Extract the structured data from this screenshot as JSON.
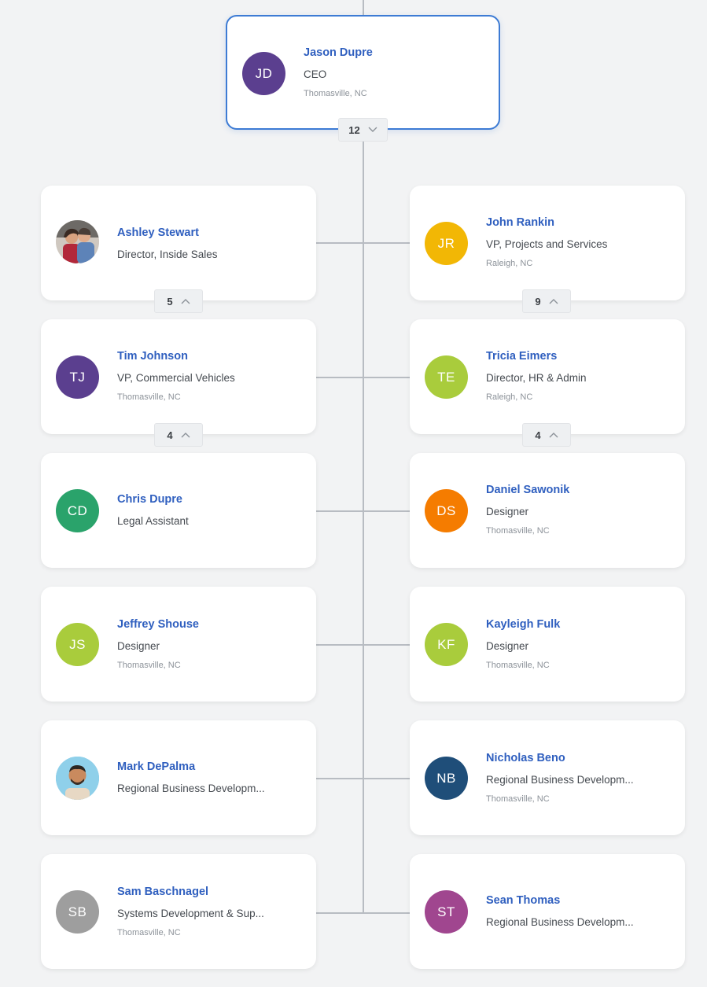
{
  "root": {
    "initials": "JD",
    "color": "#5b3f8f",
    "name": "Jason Dupre",
    "title": "CEO",
    "location": "Thomasville, NC",
    "reports_count": "12"
  },
  "left": [
    {
      "name": "Ashley Stewart",
      "title": "Director, Inside Sales",
      "location": "",
      "photo": true,
      "reports_count": "5"
    },
    {
      "initials": "TJ",
      "color": "#5b3f8f",
      "name": "Tim Johnson",
      "title": "VP, Commercial Vehicles",
      "location": "Thomasville, NC",
      "reports_count": "4"
    },
    {
      "initials": "CD",
      "color": "#2aa36b",
      "name": "Chris Dupre",
      "title": "Legal Assistant",
      "location": ""
    },
    {
      "initials": "JS",
      "color": "#a9cc3c",
      "name": "Jeffrey Shouse",
      "title": "Designer",
      "location": "Thomasville, NC"
    },
    {
      "name": "Mark DePalma",
      "title": "Regional Business Developm...",
      "location": "",
      "photo": true
    },
    {
      "initials": "SB",
      "color": "#9e9e9e",
      "name": "Sam Baschnagel",
      "title": "Systems Development & Sup...",
      "location": "Thomasville, NC"
    }
  ],
  "right": [
    {
      "initials": "JR",
      "color": "#f2b705",
      "name": "John Rankin",
      "title": "VP, Projects and Services",
      "location": "Raleigh, NC",
      "reports_count": "9"
    },
    {
      "initials": "TE",
      "color": "#a9cc3c",
      "name": "Tricia Eimers",
      "title": "Director, HR & Admin",
      "location": "Raleigh, NC",
      "reports_count": "4"
    },
    {
      "initials": "DS",
      "color": "#f57c00",
      "name": "Daniel Sawonik",
      "title": "Designer",
      "location": "Thomasville, NC"
    },
    {
      "initials": "KF",
      "color": "#a9cc3c",
      "name": "Kayleigh Fulk",
      "title": "Designer",
      "location": "Thomasville, NC"
    },
    {
      "initials": "NB",
      "color": "#1f4e79",
      "name": "Nicholas Beno",
      "title": "Regional Business Developm...",
      "location": "Thomasville, NC"
    },
    {
      "initials": "ST",
      "color": "#a0468f",
      "name": "Sean Thomas",
      "title": "Regional Business Developm...",
      "location": ""
    }
  ]
}
